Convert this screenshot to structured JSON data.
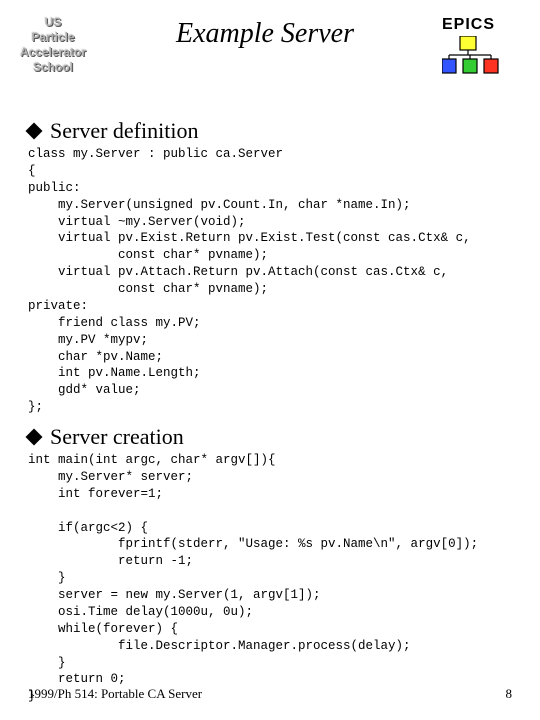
{
  "header": {
    "logo_left_l1": "US",
    "logo_left_l2": "Particle",
    "logo_left_l3": "Accelerator",
    "logo_left_l4": "School",
    "title": "Example Server",
    "epics_label": "EPICS"
  },
  "sections": {
    "s1_title": "Server definition",
    "s1_code": "class my.Server : public ca.Server\n{\npublic:\n    my.Server(unsigned pv.Count.In, char *name.In);\n    virtual ~my.Server(void);\n    virtual pv.Exist.Return pv.Exist.Test(const cas.Ctx& c,\n            const char* pvname);\n    virtual pv.Attach.Return pv.Attach(const cas.Ctx& c,\n            const char* pvname);\nprivate:\n    friend class my.PV;\n    my.PV *mypv;\n    char *pv.Name;\n    int pv.Name.Length;\n    gdd* value;\n};",
    "s2_title": "Server creation",
    "s2_code": "int main(int argc, char* argv[]){\n    my.Server* server;\n    int forever=1;\n\n    if(argc<2) {\n            fprintf(stderr, \"Usage: %s pv.Name\\n\", argv[0]);\n            return -1;\n    }\n    server = new my.Server(1, argv[1]);\n    osi.Time delay(1000u, 0u);\n    while(forever) {\n            file.Descriptor.Manager.process(delay);\n    }\n    return 0;\n}"
  },
  "footer": {
    "left": "1999/Ph 514: Portable CA Server",
    "right": "8"
  }
}
